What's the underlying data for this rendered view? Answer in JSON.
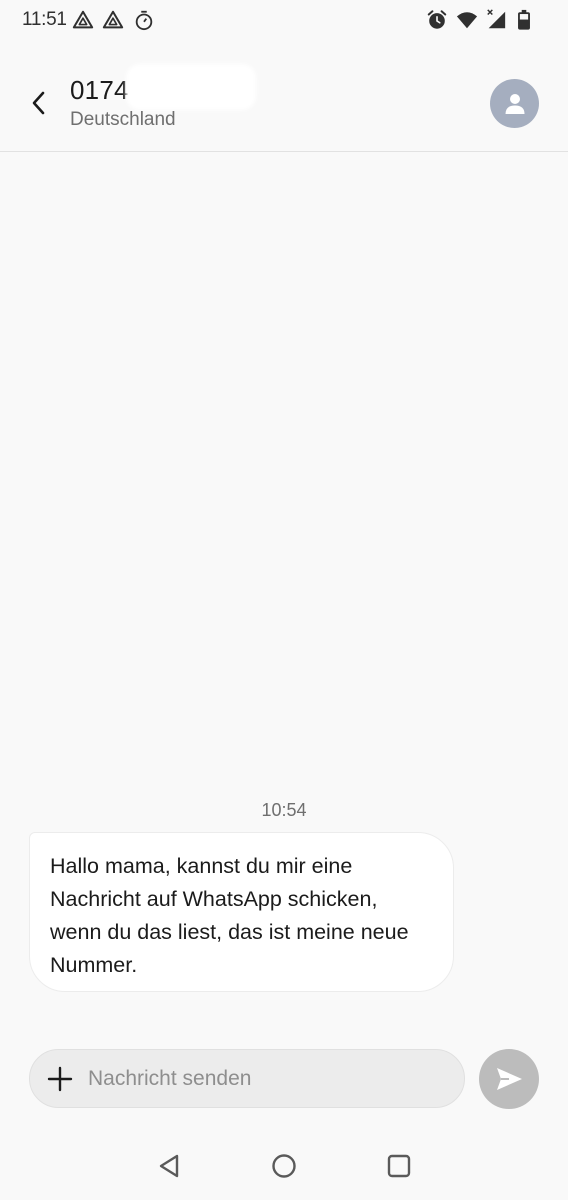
{
  "status_bar": {
    "time": "11:51",
    "left_icons": [
      "drive-icon",
      "drive-icon",
      "timer-icon"
    ],
    "right_icons": [
      "alarm-icon",
      "wifi-icon",
      "signal-icon",
      "battery-icon"
    ]
  },
  "header": {
    "contact_number": "0174",
    "contact_country": "Deutschland",
    "back_icon": "back-arrow-icon",
    "avatar_icon": "person-icon"
  },
  "conversation": {
    "timestamp": "10:54",
    "messages": [
      {
        "direction": "incoming",
        "lines": [
          "Hallo mama, kannst du mir eine",
          "Nachricht auf WhatsApp schicken,",
          "wenn du das liest, das ist meine neue",
          "Nummer."
        ]
      }
    ]
  },
  "composer": {
    "placeholder": "Nachricht senden",
    "value": "",
    "add_icon": "plus-icon",
    "send_icon": "send-icon"
  },
  "nav_bar": {
    "buttons": [
      "back-triangle-icon",
      "home-circle-icon",
      "recents-square-icon"
    ]
  },
  "colors": {
    "background": "#f9f9f9",
    "bubble": "#ffffff",
    "avatar": "#a5aebf",
    "send_button": "#bcbcbc",
    "composer": "#ececec"
  }
}
